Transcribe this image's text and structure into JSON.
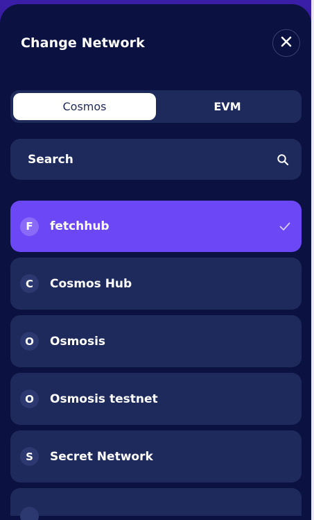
{
  "modal": {
    "title": "Change Network"
  },
  "tabs": [
    {
      "label": "Cosmos",
      "active": true
    },
    {
      "label": "EVM",
      "active": false
    }
  ],
  "search": {
    "placeholder": "Search",
    "value": ""
  },
  "networks": [
    {
      "initial": "F",
      "name": "fetchhub",
      "selected": true
    },
    {
      "initial": "C",
      "name": "Cosmos Hub",
      "selected": false
    },
    {
      "initial": "O",
      "name": "Osmosis",
      "selected": false
    },
    {
      "initial": "O",
      "name": "Osmosis testnet",
      "selected": false
    },
    {
      "initial": "S",
      "name": "Secret Network",
      "selected": false
    }
  ],
  "colors": {
    "sheet_bg": "#0b1140",
    "card_bg": "#1f2a5c",
    "selected_bg": "#6b47f5",
    "accent_text": "#ffffff"
  }
}
